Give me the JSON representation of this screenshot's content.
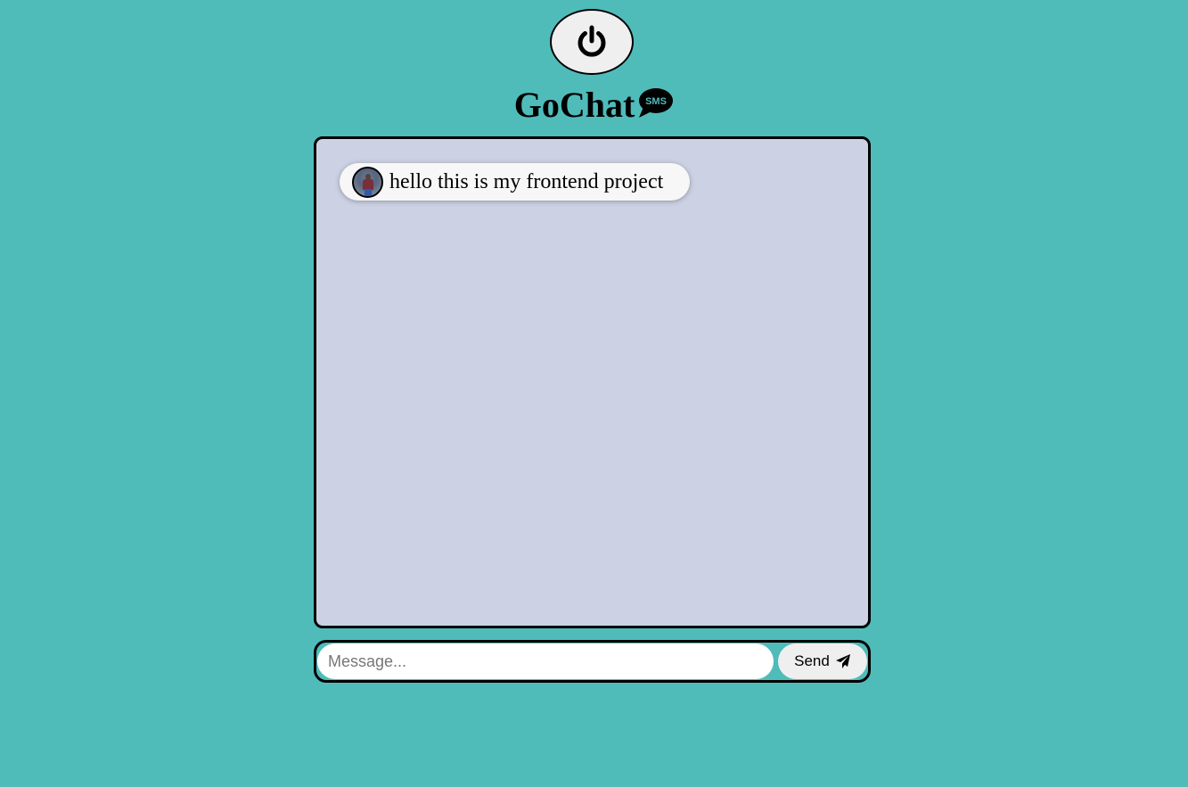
{
  "header": {
    "power_icon": "power-icon",
    "title": "GoChat",
    "title_badge_text": "SMS",
    "title_badge_icon": "sms-chat-bubble-icon"
  },
  "chat": {
    "messages": [
      {
        "avatar": "user-avatar",
        "text": "hello this is my frontend project"
      }
    ]
  },
  "composer": {
    "placeholder": "Message...",
    "value": "",
    "send_label": "Send",
    "send_icon": "paper-plane-icon"
  },
  "colors": {
    "background": "#4fbcba",
    "chat_box": "#ccd1e4",
    "bubble": "#f7f7f7",
    "button": "#efefef"
  }
}
